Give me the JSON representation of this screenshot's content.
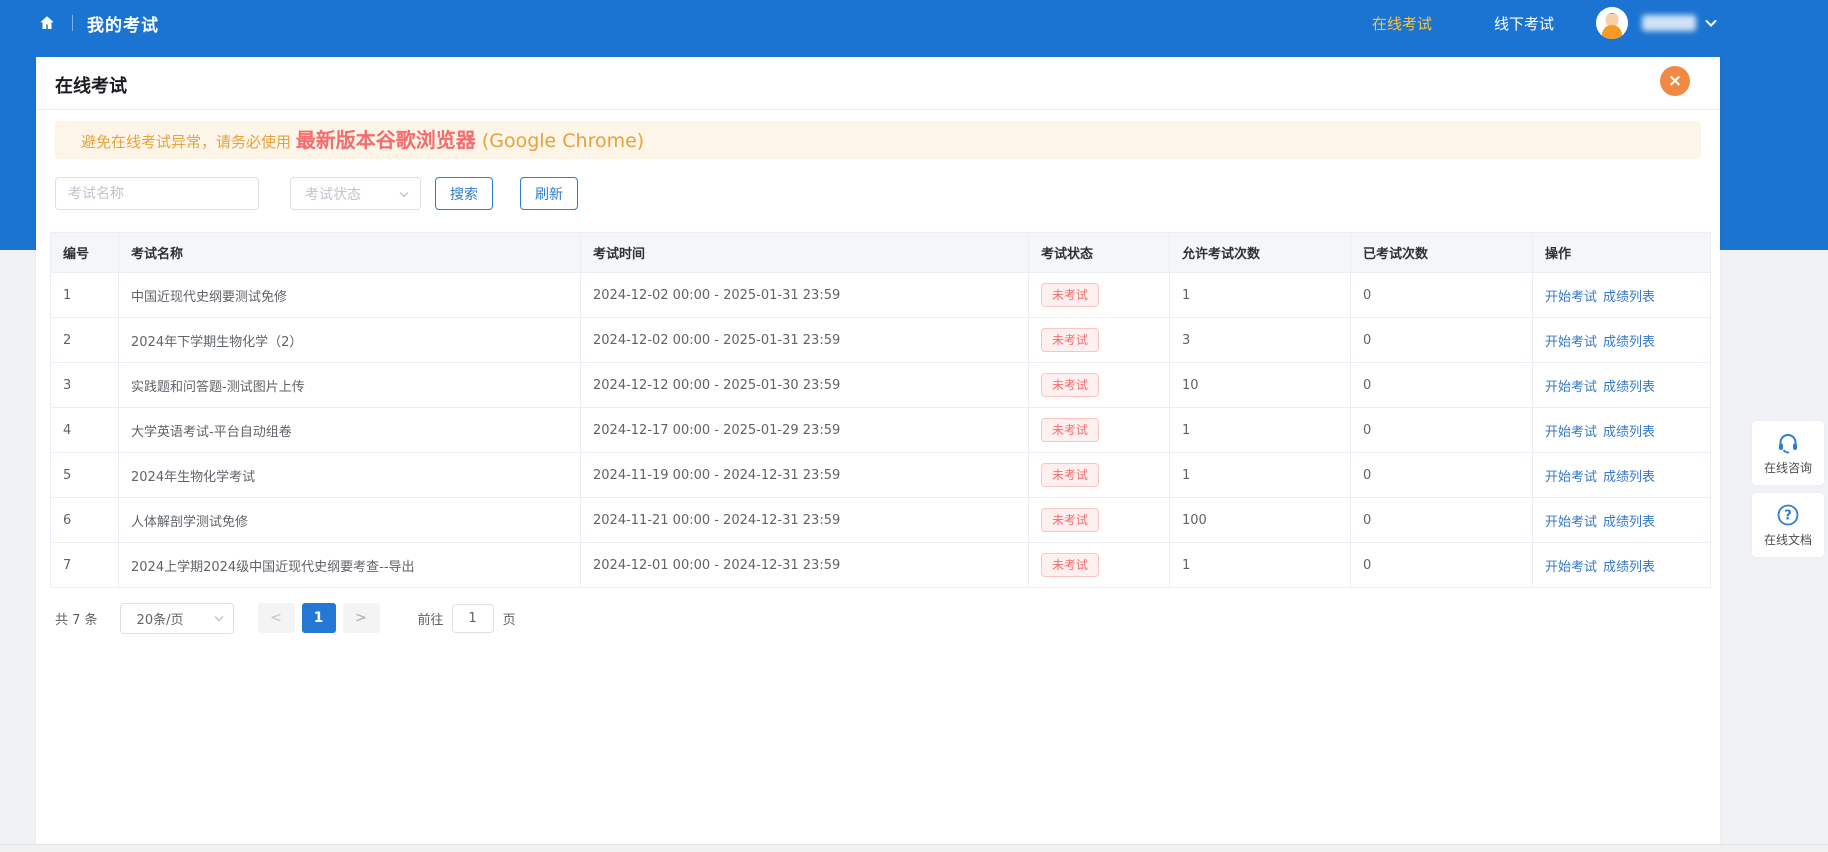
{
  "navbar": {
    "title": "我的考试",
    "items": [
      {
        "label": "在线考试",
        "active": true
      },
      {
        "label": "线下考试",
        "active": false
      }
    ]
  },
  "panel": {
    "title": "在线考试"
  },
  "warning": {
    "prefix": "避免在线考试异常，请务必使用 ",
    "highlight": "最新版本谷歌浏览器",
    "suffix": " (Google Chrome)"
  },
  "filters": {
    "name_placeholder": "考试名称",
    "status_placeholder": "考试状态",
    "search_label": "搜索",
    "refresh_label": "刷新"
  },
  "table": {
    "columns": [
      "编号",
      "考试名称",
      "考试时间",
      "考试状态",
      "允许考试次数",
      "已考试次数",
      "操作"
    ],
    "rows": [
      {
        "no": "1",
        "name": "中国近现代史纲要测试免修",
        "time": "2024-12-02 00:00 - 2025-01-31 23:59",
        "status": "未考试",
        "allowed": "1",
        "taken": "0",
        "actions": [
          "开始考试",
          "成绩列表"
        ]
      },
      {
        "no": "2",
        "name": "2024年下学期生物化学（2）",
        "time": "2024-12-02 00:00 - 2025-01-31 23:59",
        "status": "未考试",
        "allowed": "3",
        "taken": "0",
        "actions": [
          "开始考试",
          "成绩列表"
        ]
      },
      {
        "no": "3",
        "name": "实践题和问答题-测试图片上传",
        "time": "2024-12-12 00:00 - 2025-01-30 23:59",
        "status": "未考试",
        "allowed": "10",
        "taken": "0",
        "actions": [
          "开始考试",
          "成绩列表"
        ]
      },
      {
        "no": "4",
        "name": "大学英语考试-平台自动组卷",
        "time": "2024-12-17 00:00 - 2025-01-29 23:59",
        "status": "未考试",
        "allowed": "1",
        "taken": "0",
        "actions": [
          "开始考试",
          "成绩列表"
        ]
      },
      {
        "no": "5",
        "name": "2024年生物化学考试",
        "time": "2024-11-19 00:00 - 2024-12-31 23:59",
        "status": "未考试",
        "allowed": "1",
        "taken": "0",
        "actions": [
          "开始考试",
          "成绩列表"
        ]
      },
      {
        "no": "6",
        "name": "人体解剖学测试免修",
        "time": "2024-11-21 00:00 - 2024-12-31 23:59",
        "status": "未考试",
        "allowed": "100",
        "taken": "0",
        "actions": [
          "开始考试",
          "成绩列表"
        ]
      },
      {
        "no": "7",
        "name": "2024上学期2024级中国近现代史纲要考查--导出",
        "time": "2024-12-01 00:00 - 2024-12-31 23:59",
        "status": "未考试",
        "allowed": "1",
        "taken": "0",
        "actions": [
          "开始考试",
          "成绩列表"
        ]
      }
    ]
  },
  "pagination": {
    "total": "共 7 条",
    "page_size": "20条/页",
    "prev": "<",
    "current_page": "1",
    "next": ">",
    "goto_label": "前往",
    "goto_value": "1",
    "page_label": "页"
  },
  "floating": [
    {
      "icon": "headset-icon",
      "label": "在线咨询"
    },
    {
      "icon": "question-icon",
      "label": "在线文档"
    }
  ],
  "icons": {
    "home": "home-icon",
    "user_chevron": "chevron-down-icon",
    "close": "×",
    "select_arrow": "chevron-down-icon"
  },
  "colors": {
    "navbar_blue": "#1b74d1",
    "active_tab_yellow": "#f7c544",
    "close_button_orange": "#ef8943",
    "warning_bg": "#fdf5e8",
    "warning_orange": "#e6a23c",
    "alert_red": "#f56c6c",
    "link_blue": "#3578c8",
    "button_blue": "#2d7cd1",
    "current_page_blue": "#2577d4",
    "badge_bg": "#fef0f0",
    "badge_border": "#fbc4c4"
  }
}
